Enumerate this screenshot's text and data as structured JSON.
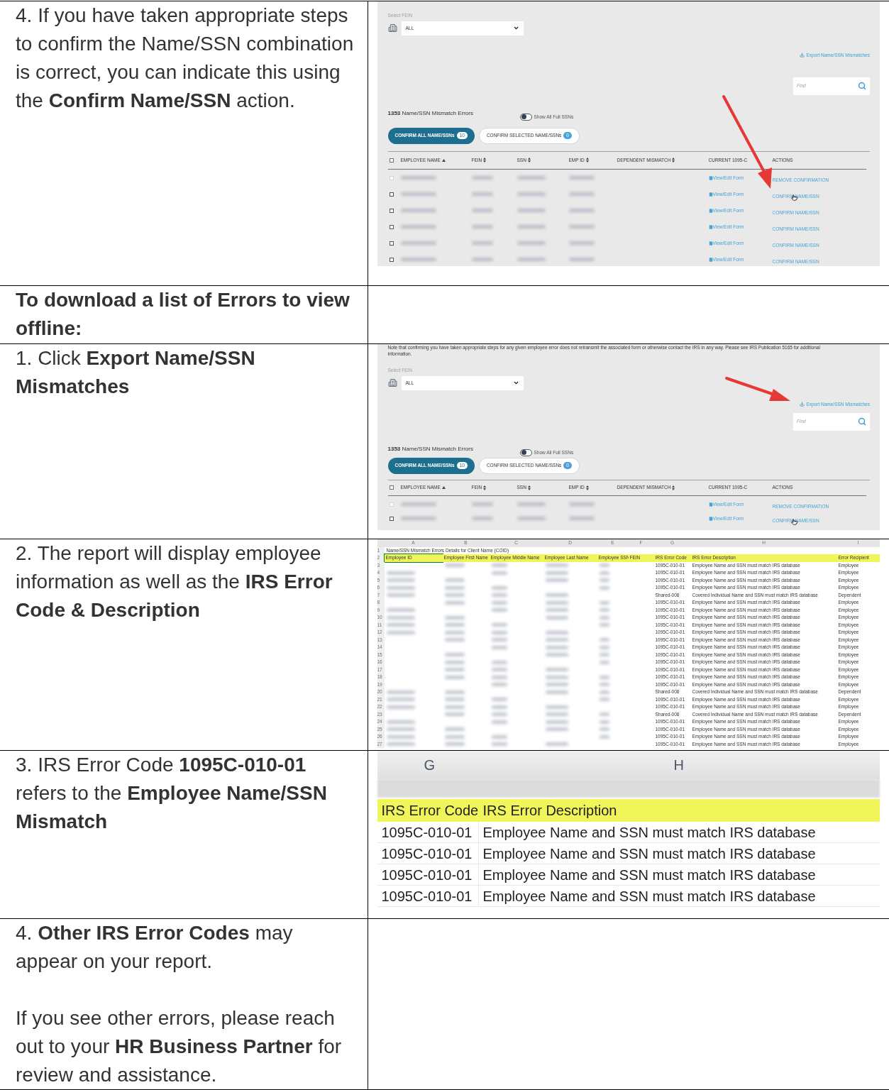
{
  "rows": [
    {
      "kind": "step",
      "paragraphs": [
        "4. If you have taken appropriate steps to confirm the Name/SSN combination is correct, you can indicate this using the **Confirm Name/SSN** action."
      ],
      "figure": {
        "kind": "portal",
        "annotations": [
          {
            "kind": "arrow_to_action"
          }
        ],
        "select_all_checked": false,
        "fein_label": "Select FEIN",
        "fein_value": "ALL",
        "export_link": "Export Name/SSN Mismatches",
        "find_placeholder": "Find",
        "count": "1353",
        "count_label": "Name/SSN Mismatch Errors",
        "toggle_label": "Show All Full SSNs",
        "toggle_on": false,
        "buttons": [
          {
            "kind": "primary",
            "label": "CONFIRM ALL NAME/SSNs",
            "badge": "10"
          },
          {
            "kind": "secondary",
            "label": "CONFIRM SELECTED NAME/SSNs",
            "badge": "0"
          }
        ],
        "columns": [
          {
            "label": "EMPLOYEE NAME",
            "kind": "sorted"
          },
          {
            "label": "FEIN",
            "kind": "sortable"
          },
          {
            "label": "SSN",
            "kind": "sortable"
          },
          {
            "label": "EMP ID",
            "kind": "sortable"
          },
          {
            "label": "DEPENDENT MISMATCH",
            "kind": "sortable"
          },
          {
            "label": "CURRENT 1095-C",
            "kind": "plain"
          },
          {
            "label": "ACTIONS",
            "kind": "plain"
          }
        ],
        "rows": [
          {
            "disabled": true,
            "hovered": false,
            "form_link": "View/Edit Form",
            "action": "REMOVE CONFIRMATION"
          },
          {
            "disabled": false,
            "hovered": true,
            "form_link": "View/Edit Form",
            "action": "CONFIRM NAME/SSN"
          },
          {
            "disabled": false,
            "hovered": false,
            "form_link": "View/Edit Form",
            "action": "CONFIRM NAME/SSN"
          },
          {
            "disabled": false,
            "hovered": false,
            "form_link": "View/Edit Form",
            "action": "CONFIRM NAME/SSN"
          },
          {
            "disabled": false,
            "hovered": false,
            "form_link": "View/Edit Form",
            "action": "CONFIRM NAME/SSN"
          },
          {
            "disabled": false,
            "hovered": false,
            "form_link": "View/Edit Form",
            "action": "CONFIRM NAME/SSN"
          }
        ]
      }
    },
    {
      "kind": "heading",
      "paragraphs": [
        "To download a list of Errors to view offline:"
      ]
    },
    {
      "kind": "step",
      "paragraphs": [
        "1. Click **Export Name/SSN Mismatches**"
      ],
      "figure": {
        "kind": "portal",
        "annotations": [
          {
            "kind": "arrow_to_export"
          }
        ],
        "select_all_checked": false,
        "note": "Note that confirming you have taken appropriate steps for any given employee error does not retransmit the associated form or otherwise contact the IRS in any way. Please see IRS Publication 5165 for additional information.",
        "fein_label": "Select FEIN",
        "fein_value": "ALL",
        "export_link": "Export Name/SSN Mismatches",
        "find_placeholder": "Find",
        "count": "1353",
        "count_label": "Name/SSN Mismatch Errors",
        "toggle_label": "Show All Full SSNs",
        "toggle_on": false,
        "buttons": [
          {
            "kind": "primary",
            "label": "CONFIRM ALL NAME/SSNs",
            "badge": "10"
          },
          {
            "kind": "secondary",
            "label": "CONFIRM SELECTED NAME/SSNs",
            "badge": "0"
          }
        ],
        "columns": [
          {
            "label": "EMPLOYEE NAME",
            "kind": "sorted"
          },
          {
            "label": "FEIN",
            "kind": "sortable"
          },
          {
            "label": "SSN",
            "kind": "sortable"
          },
          {
            "label": "EMP ID",
            "kind": "sortable"
          },
          {
            "label": "DEPENDENT MISMATCH",
            "kind": "sortable"
          },
          {
            "label": "CURRENT 1095-C",
            "kind": "plain"
          },
          {
            "label": "ACTIONS",
            "kind": "plain"
          }
        ],
        "rows": [
          {
            "disabled": true,
            "hovered": false,
            "form_link": "View/Edit Form",
            "action": "REMOVE CONFIRMATION"
          },
          {
            "disabled": false,
            "hovered": true,
            "form_link": "View/Edit Form",
            "action": "CONFIRM NAME/SSN"
          }
        ]
      }
    },
    {
      "kind": "step",
      "paragraphs": [
        "2. The report will display employee information as well as the **IRS Error Code & Description**"
      ],
      "figure": {
        "kind": "spreadsheet",
        "column_letters": [
          "A",
          "B",
          "C",
          "D",
          "E",
          "F",
          "G",
          "H",
          "I"
        ],
        "title_row": "1",
        "title": "Name/SSN Mismatch Errors Details for Client Name (COID)",
        "header_row": "2",
        "headers": [
          "Employee ID",
          "Employee First Name",
          "Employee Middle Name",
          "Employee Last Name",
          "Employee SSN",
          "FEIN",
          "IRS Error Code",
          "IRS Error Description",
          "Error Recipient"
        ],
        "rows": [
          {
            "num": "3",
            "code": "1095C-010-01",
            "description": "Employee Name and SSN must match IRS database",
            "recipient": "Employee"
          },
          {
            "num": "4",
            "code": "1095C-010-01",
            "description": "Employee Name and SSN must match IRS database",
            "recipient": "Employee"
          },
          {
            "num": "5",
            "code": "1095C-010-01",
            "description": "Employee Name and SSN must match IRS database",
            "recipient": "Employee"
          },
          {
            "num": "6",
            "code": "1095C-010-01",
            "description": "Employee Name and SSN must match IRS database",
            "recipient": "Employee"
          },
          {
            "num": "7",
            "code": "Shared-008",
            "description": "Covered Individual Name and SSN must match IRS database",
            "recipient": "Dependent"
          },
          {
            "num": "8",
            "code": "1095C-010-01",
            "description": "Employee Name and SSN must match IRS database",
            "recipient": "Employee"
          },
          {
            "num": "9",
            "code": "1095C-010-01",
            "description": "Employee Name and SSN must match IRS database",
            "recipient": "Employee"
          },
          {
            "num": "10",
            "code": "1095C-010-01",
            "description": "Employee Name and SSN must match IRS database",
            "recipient": "Employee"
          },
          {
            "num": "11",
            "code": "1095C-010-01",
            "description": "Employee Name and SSN must match IRS database",
            "recipient": "Employee"
          },
          {
            "num": "12",
            "code": "1095C-010-01",
            "description": "Employee Name and SSN must match IRS database",
            "recipient": "Employee"
          },
          {
            "num": "13",
            "code": "1095C-010-01",
            "description": "Employee Name and SSN must match IRS database",
            "recipient": "Employee"
          },
          {
            "num": "14",
            "code": "1095C-010-01",
            "description": "Employee Name and SSN must match IRS database",
            "recipient": "Employee"
          },
          {
            "num": "15",
            "code": "1095C-010-01",
            "description": "Employee Name and SSN must match IRS database",
            "recipient": "Employee"
          },
          {
            "num": "16",
            "code": "1095C-010-01",
            "description": "Employee Name and SSN must match IRS database",
            "recipient": "Employee"
          },
          {
            "num": "17",
            "code": "1095C-010-01",
            "description": "Employee Name and SSN must match IRS database",
            "recipient": "Employee"
          },
          {
            "num": "18",
            "code": "1095C-010-01",
            "description": "Employee Name and SSN must match IRS database",
            "recipient": "Employee"
          },
          {
            "num": "19",
            "code": "1095C-010-01",
            "description": "Employee Name and SSN must match IRS database",
            "recipient": "Employee"
          },
          {
            "num": "20",
            "code": "Shared-008",
            "description": "Covered Individual Name and SSN must match IRS database",
            "recipient": "Dependent"
          },
          {
            "num": "21",
            "code": "1095C-010-01",
            "description": "Employee Name and SSN must match IRS database",
            "recipient": "Employee"
          },
          {
            "num": "22",
            "code": "1095C-010-01",
            "description": "Employee Name and SSN must match IRS database",
            "recipient": "Employee"
          },
          {
            "num": "23",
            "code": "Shared-008",
            "description": "Covered Individual Name and SSN must match IRS database",
            "recipient": "Dependent"
          },
          {
            "num": "24",
            "code": "1095C-010-01",
            "description": "Employee Name and SSN must match IRS database",
            "recipient": "Employee"
          },
          {
            "num": "25",
            "code": "1095C-010-01",
            "description": "Employee Name and SSN must match IRS database",
            "recipient": "Employee"
          },
          {
            "num": "26",
            "code": "1095C-010-01",
            "description": "Employee Name and SSN must match IRS database",
            "recipient": "Employee"
          },
          {
            "num": "27",
            "code": "1095C-010-01",
            "description": "Employee Name and SSN must match IRS database",
            "recipient": "Employee"
          }
        ]
      }
    },
    {
      "kind": "step",
      "paragraphs": [
        "3. IRS Error Code **1095C-010-01** refers to the **Employee Name/SSN Mismatch**"
      ],
      "figure": {
        "kind": "sheet_zoom",
        "column_letters": [
          "G",
          "H"
        ],
        "headers": [
          "IRS Error Code",
          "IRS Error Description"
        ],
        "rows": [
          {
            "code": "1095C-010-01",
            "description": "Employee Name and SSN must match IRS database"
          },
          {
            "code": "1095C-010-01",
            "description": "Employee Name and SSN must match IRS database"
          },
          {
            "code": "1095C-010-01",
            "description": "Employee Name and SSN must match IRS database"
          },
          {
            "code": "1095C-010-01",
            "description": "Employee Name and SSN must match IRS database"
          }
        ]
      }
    },
    {
      "kind": "step",
      "paragraphs": [
        "4. **Other IRS Error Codes** may appear on your report.",
        "If you see other errors, please reach out to your **HR Business Partner** for review and assistance."
      ]
    }
  ]
}
